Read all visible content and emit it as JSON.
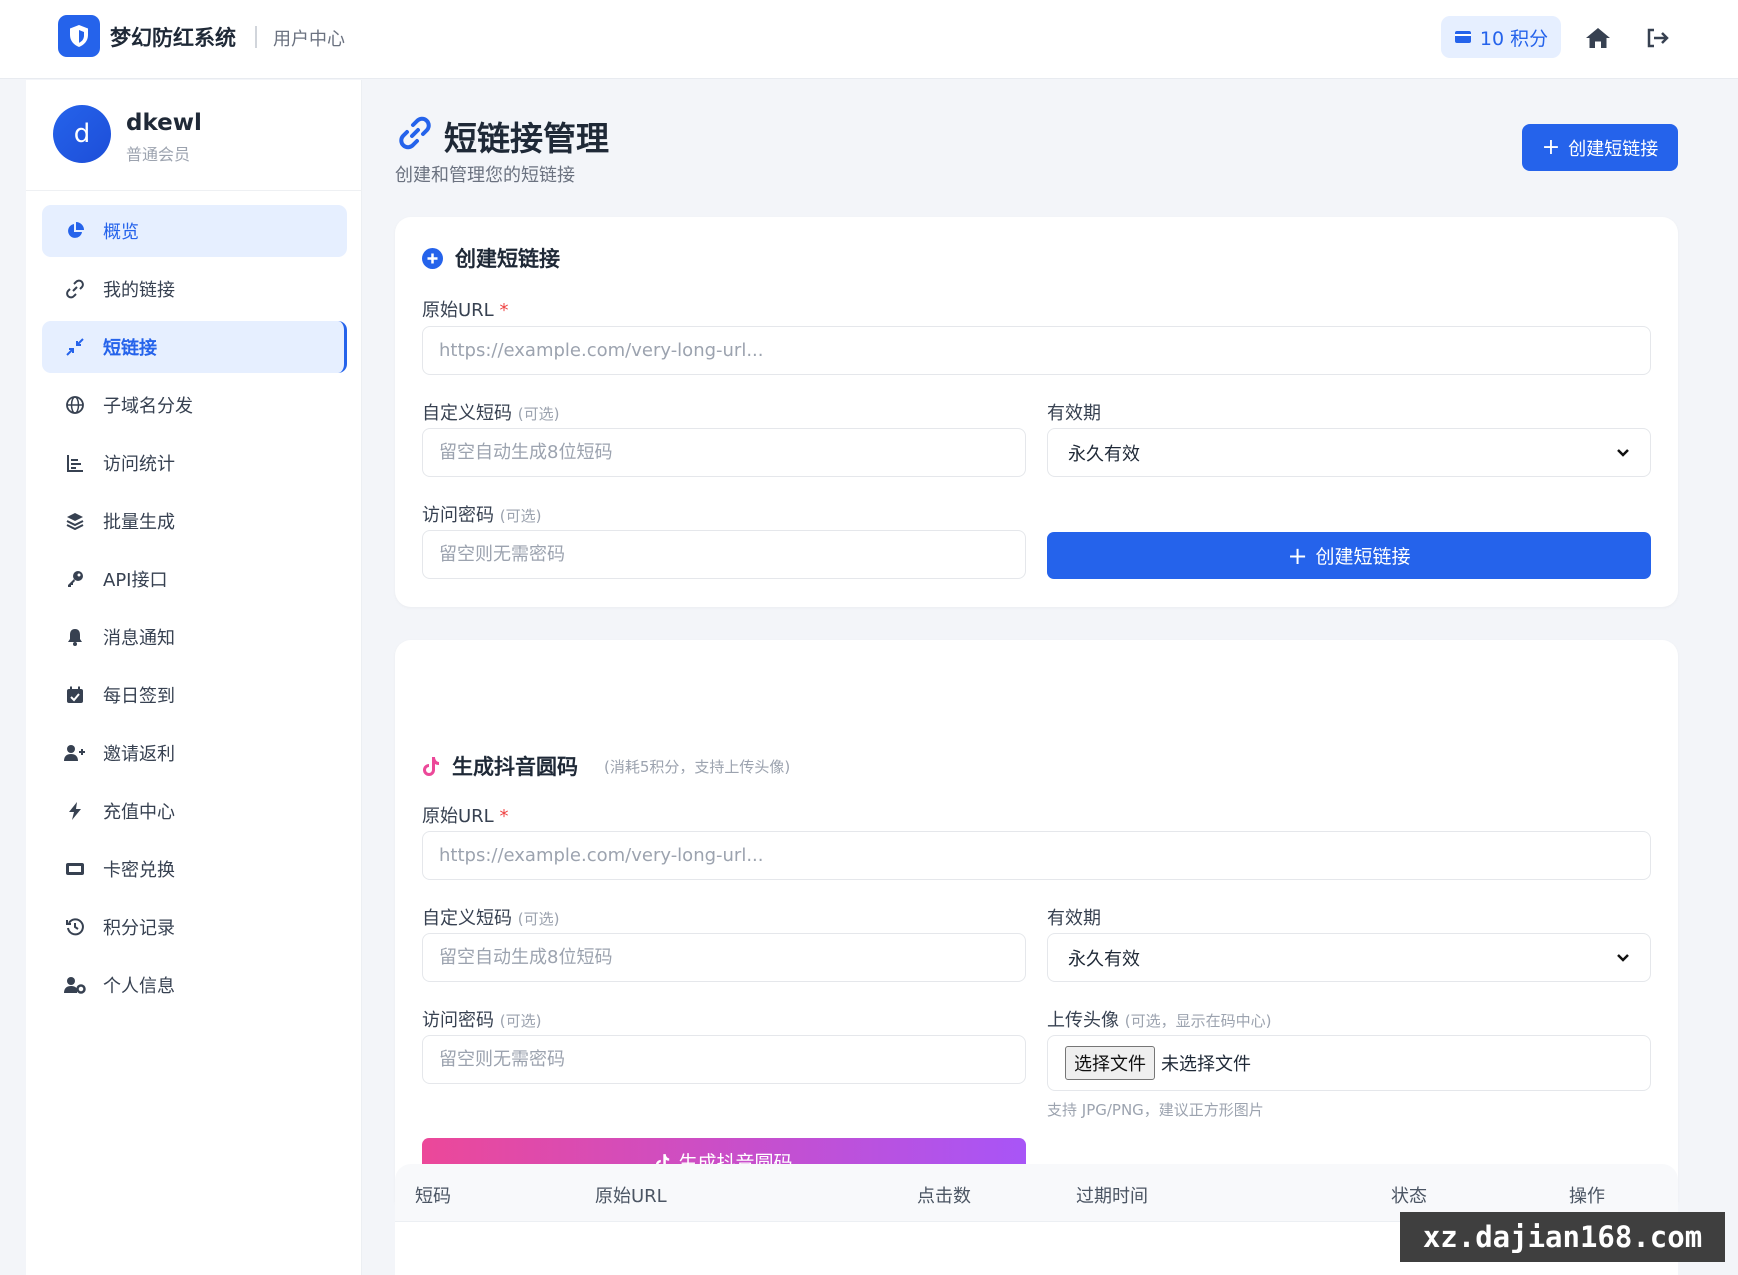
{
  "topbar": {
    "brand": "梦幻防红系统",
    "section": "用户中心",
    "points_label": "10 积分"
  },
  "user": {
    "avatar_letter": "d",
    "name": "dkewl",
    "level": "普通会员"
  },
  "sidebar": {
    "items": [
      {
        "label": "概览",
        "icon": "pie-chart-icon"
      },
      {
        "label": "我的链接",
        "icon": "link-icon"
      },
      {
        "label": "短链接",
        "icon": "compress-icon"
      },
      {
        "label": "子域名分发",
        "icon": "globe-icon"
      },
      {
        "label": "访问统计",
        "icon": "bar-chart-icon"
      },
      {
        "label": "批量生成",
        "icon": "layers-icon"
      },
      {
        "label": "API接口",
        "icon": "key-icon"
      },
      {
        "label": "消息通知",
        "icon": "bell-icon"
      },
      {
        "label": "每日签到",
        "icon": "calendar-icon"
      },
      {
        "label": "邀请返利",
        "icon": "user-plus-icon"
      },
      {
        "label": "充值中心",
        "icon": "bolt-icon"
      },
      {
        "label": "卡密兑换",
        "icon": "ticket-icon"
      },
      {
        "label": "积分记录",
        "icon": "history-icon"
      },
      {
        "label": "个人信息",
        "icon": "user-gear-icon"
      }
    ]
  },
  "page": {
    "title": "短链接管理",
    "subtitle": "创建和管理您的短链接",
    "create_button": "创建短链接"
  },
  "create_card": {
    "title": "创建短链接",
    "url_label": "原始URL",
    "url_required": "*",
    "url_placeholder": "https://example.com/very-long-url...",
    "code_label": "自定义短码",
    "code_optional": "(可选)",
    "code_placeholder": "留空自动生成8位短码",
    "expire_label": "有效期",
    "expire_value": "永久有效",
    "password_label": "访问密码",
    "password_optional": "(可选)",
    "password_placeholder": "留空则无需密码",
    "submit_label": "创建短链接"
  },
  "douyin_card": {
    "title": "生成抖音圆码",
    "hint": "(消耗5积分，支持上传头像)",
    "url_label": "原始URL",
    "url_required": "*",
    "url_placeholder": "https://example.com/very-long-url...",
    "code_label": "自定义短码",
    "code_optional": "(可选)",
    "code_placeholder": "留空自动生成8位短码",
    "expire_label": "有效期",
    "expire_value": "永久有效",
    "password_label": "访问密码",
    "password_optional": "(可选)",
    "password_placeholder": "留空则无需密码",
    "avatar_label": "上传头像",
    "avatar_optional": "(可选，显示在码中心)",
    "file_button": "选择文件",
    "file_status": "未选择文件",
    "file_hint": "支持 JPG/PNG，建议正方形图片",
    "submit_label": "生成抖音圆码"
  },
  "table": {
    "headers": [
      "短码",
      "原始URL",
      "点击数",
      "过期时间",
      "状态",
      "操作"
    ]
  },
  "watermark": "xz.dajian168.com",
  "colors": {
    "primary": "#2563eb",
    "gradient_start": "#ec4899",
    "gradient_end": "#a855f7",
    "required": "#ef4444"
  }
}
